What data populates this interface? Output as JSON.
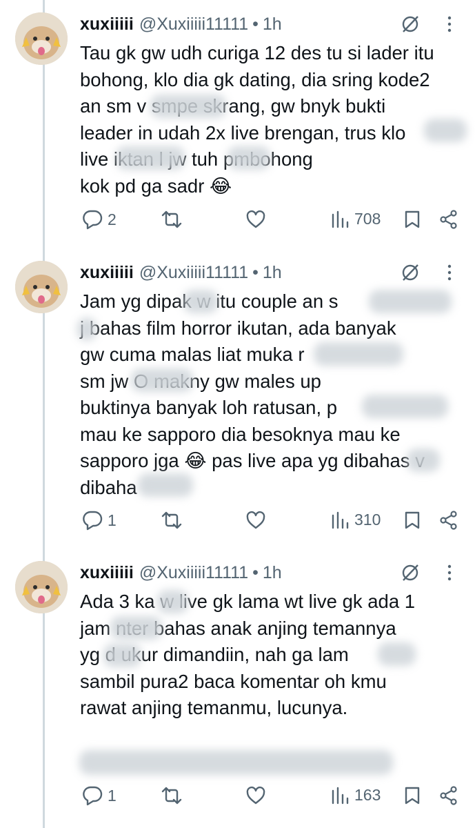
{
  "tweets": [
    {
      "name": "xuxiiiii",
      "handle": "@Xuxiiiii11111",
      "separator": "•",
      "time": "1h",
      "text": "Tau gk gw udh curiga 12 des tu si lader itu\nbohong, klo dia gk dating, dia sring kode2\nan sm v          smpe skrang, gw bnyk bukti\nleader in udah 2x live brengan, trus klo\nlive             iktan l      jw tuh pmbohong\nkok pd ga sadr 😂",
      "replies": "2",
      "views": "708"
    },
    {
      "name": "xuxiiiii",
      "handle": "@Xuxiiiii11111",
      "separator": "•",
      "time": "1h",
      "text": "Jam yg dipak      w itu couple an s\nj  bahas film horror ikutan, ada banyak\ngw cuma malas liat muka r\nsm jw           O makny gw males up\nbuktinya banyak loh ratusan, p\nmau ke sapporo dia besoknya mau ke\nsapporo jga 😂 pas live apa yg dibahas     v\ndibaha",
      "replies": "1",
      "views": "310"
    },
    {
      "name": "xuxiiiii",
      "handle": "@Xuxiiiii11111",
      "separator": "•",
      "time": "1h",
      "text": "Ada 3 ka      w live gk lama wt live gk ada 1\njam       nter bahas anak anjing temannya\nyg d     ukur dimandiin, nah ga lam\nsambil pura2 baca komentar oh kmu\nrawat anjing temanmu, lucunya.",
      "replies": "1",
      "views": "163"
    }
  ],
  "icons": {
    "reply": "reply-icon",
    "retweet": "retweet-icon",
    "like": "heart-icon",
    "views": "views-icon",
    "bookmark": "bookmark-icon",
    "share": "share-icon",
    "grok": "grok-icon",
    "more": "more-icon"
  },
  "colors": {
    "text": "#0f1419",
    "secondary": "#536471",
    "thread_line": "#cfd9de"
  }
}
